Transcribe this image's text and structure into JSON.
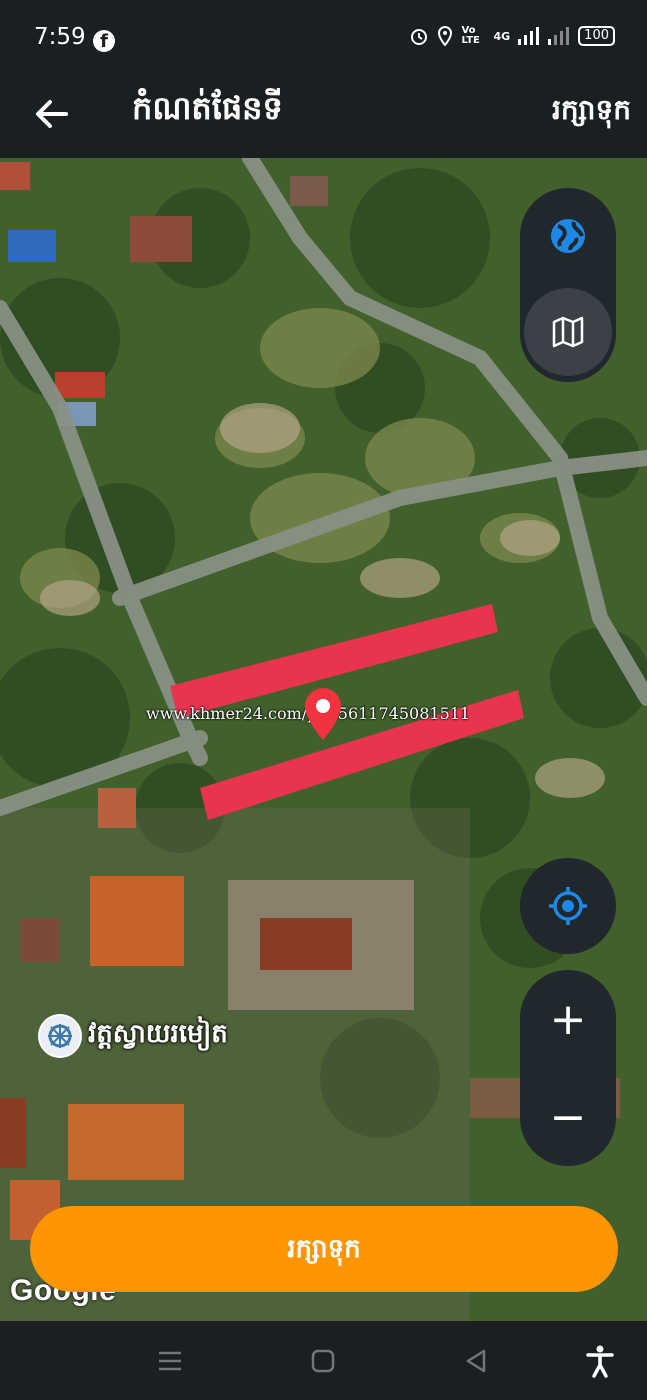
{
  "status_bar": {
    "time": "7:59",
    "notification_icon": "facebook-icon",
    "volte": "Vo LTE",
    "network": "4G",
    "battery": "100"
  },
  "app_bar": {
    "title": "កំណត់ផែនទី",
    "save_label": "រក្សាទុក"
  },
  "map": {
    "watermark_text": "www.khmer24.com/p445611745081511",
    "place_label": "វត្តស្វាយរមៀត",
    "attribution": "Google",
    "highlight_color": "#e8344f",
    "pin_color": "#f0333f"
  },
  "controls": {
    "globe": "globe-icon",
    "map_view": "map-icon",
    "locate": "locate-icon",
    "zoom_in": "+",
    "zoom_out": "−"
  },
  "save_button": {
    "label": "រក្សាទុក",
    "color": "#ff9500"
  },
  "nav_bar": {
    "recent": "menu-icon",
    "home": "home-icon",
    "back": "back-triangle-icon",
    "accessibility": "accessibility-icon"
  }
}
